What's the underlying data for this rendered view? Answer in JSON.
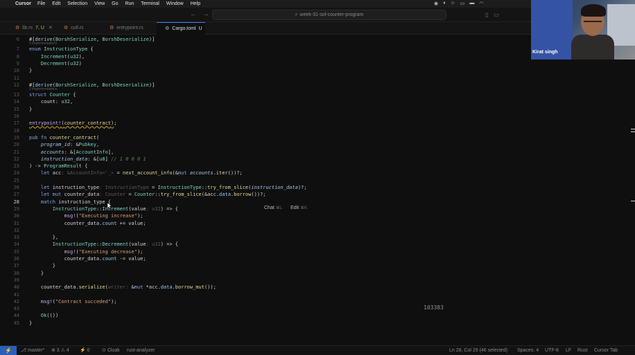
{
  "menubar": {
    "app": "Cursor",
    "items": [
      "File",
      "Edit",
      "Selection",
      "View",
      "Go",
      "Run",
      "Terminal",
      "Window",
      "Help"
    ]
  },
  "titlebar": {
    "search": "week-31-sol-counter-program"
  },
  "tabs": [
    {
      "name": "lib.rs",
      "mod": "7, U",
      "icon": "rust",
      "active": false
    },
    {
      "name": "coll.rs",
      "mod": "",
      "icon": "rust",
      "active": false
    },
    {
      "name": "entrypoint.rs",
      "mod": "",
      "icon": "rust",
      "active": false
    },
    {
      "name": "Cargo.toml",
      "mod": "U",
      "icon": "toml",
      "active": true
    }
  ],
  "editor": {
    "current_line": 28,
    "lines": [
      {
        "n": 6,
        "html": "#[<span class=\"at\">derive</span>(<span class=\"ty\">BorshSerialize</span>, <span class=\"ty\">BorshDeserialize</span>)]"
      },
      {
        "n": 7,
        "html": "<span class=\"kw\">enum</span> <span class=\"ty\">InstructionType</span> {"
      },
      {
        "n": 8,
        "html": "    <span class=\"ty\">Increment</span>(<span class=\"ty\">u32</span>),"
      },
      {
        "n": 9,
        "html": "    <span class=\"ty\">Decrement</span>(<span class=\"ty\">u32</span>)"
      },
      {
        "n": 10,
        "html": "}"
      },
      {
        "n": 11,
        "html": ""
      },
      {
        "n": 12,
        "html": "#[<span class=\"at\">derive</span>(<span class=\"ty\">BorshSerialize</span>, <span class=\"ty\">BorshDeserialize</span>)]"
      },
      {
        "n": 13,
        "html": "<span class=\"kw\">struct</span> <span class=\"ty\">Counter</span> {"
      },
      {
        "n": 14,
        "html": "    count: <span class=\"ty\">u32</span>,"
      },
      {
        "n": 15,
        "html": "}"
      },
      {
        "n": 16,
        "html": ""
      },
      {
        "n": 17,
        "html": "<span class=\"mc sq\">entrypoint!</span><span class=\"sq\">(<span class=\"fn\">counter_contract</span>)</span>;"
      },
      {
        "n": 18,
        "html": ""
      },
      {
        "n": 19,
        "html": "<span class=\"kw\">pub</span> <span class=\"kw\">fn</span> <span class=\"fn\">counter_contract</span>("
      },
      {
        "n": 20,
        "html": "    <span class=\"vi\">program_id</span>: &amp;<span class=\"ty\">Pubkey</span>,"
      },
      {
        "n": 21,
        "html": "    <span class=\"vi\">accounts</span>: &amp;[<span class=\"ty\">AccountInfo</span>],"
      },
      {
        "n": 22,
        "html": "    <span class=\"vi\">instruction_data</span>: &amp;[<span class=\"ty\">u8</span>] <span class=\"cm\">// 1 0 0 0 1</span>"
      },
      {
        "n": 23,
        "html": ") -&gt; <span class=\"ty\">ProgramResult</span> {"
      },
      {
        "n": 24,
        "html": "    <span class=\"kw\">let</span> acc<span class=\"gh\">: &amp;AccountInfo&lt;'_&gt;</span> = <span class=\"fn\">next_account_info</span>(&amp;<span class=\"kw\">mut</span> <span class=\"vi\">accounts</span>.<span class=\"fn\">iter</span>())?;"
      },
      {
        "n": 25,
        "html": ""
      },
      {
        "n": 26,
        "html": "    <span class=\"kw\">let</span> instruction_type<span class=\"gh\">: InstructionType</span> = <span class=\"ty\">InstructionType</span>::<span class=\"fn\">try_from_slice</span>(<span class=\"vi\">instruction_data</span>)?;"
      },
      {
        "n": 27,
        "html": "    <span class=\"kw\">let</span> <span class=\"kw\">mut</span> counter_data<span class=\"gh\">: Counter</span> = <span class=\"ty\">Counter</span>::<span class=\"fn\">try_from_slice</span>(&amp;acc.<span class=\"at\">data</span>.<span class=\"fn\">borrow</span>())?;"
      },
      {
        "n": 28,
        "html": "    <span class=\"kw\">match</span> instruction_type {"
      },
      {
        "n": 29,
        "html": "        <span class=\"ty\">InstructionType</span>::<span class=\"ty\">Increment</span>(value<span class=\"gh\">: u32</span>) =&gt; {"
      },
      {
        "n": 30,
        "html": "            <span class=\"mc\">msg!</span>(<span class=\"st\">\"Executing increase\"</span>);"
      },
      {
        "n": 31,
        "html": "            counter_data.<span class=\"at\">count</span> += value;"
      },
      {
        "n": 32,
        "html": ""
      },
      {
        "n": 33,
        "html": "        },"
      },
      {
        "n": 34,
        "html": "        <span class=\"ty\">InstructionType</span>::<span class=\"ty\">Decrement</span>(value<span class=\"gh\">: u32</span>) =&gt; {"
      },
      {
        "n": 35,
        "html": "            <span class=\"mc\">msg!</span>(<span class=\"st\">\"Executing decrease\"</span>);"
      },
      {
        "n": 36,
        "html": "            counter_data.<span class=\"at\">count</span> -= value;"
      },
      {
        "n": 37,
        "html": "        }"
      },
      {
        "n": 38,
        "html": "    }"
      },
      {
        "n": 39,
        "html": ""
      },
      {
        "n": 40,
        "html": "    counter_data.<span class=\"fn\">serialize</span>(<span class=\"gh\">writer:</span> &amp;<span class=\"kw\">mut</span> *acc.<span class=\"at\">data</span>.<span class=\"fn\">borrow_mut</span>());"
      },
      {
        "n": 41,
        "html": ""
      },
      {
        "n": 42,
        "html": "    <span class=\"mc\">msg!</span>(<span class=\"st\">\"Contract succeded\"</span>);"
      },
      {
        "n": 43,
        "html": ""
      },
      {
        "n": 44,
        "html": "    <span class=\"ty\">Ok</span>(())"
      },
      {
        "n": 45,
        "html": "}"
      }
    ],
    "hints": [
      {
        "after": 6,
        "text": "3 implementations"
      },
      {
        "after": 12,
        "text": "2 implementations"
      }
    ],
    "inline_actions": {
      "chat": "Chat",
      "chat_shortcut": "⌘L",
      "edit": "Edit",
      "edit_shortcut": "⌘K"
    },
    "overlay_number": "103383"
  },
  "statusbar": {
    "branch": "master*",
    "problems": "⊗ 3 ⚠ 4",
    "ports": "⚡ 0",
    "cloak": "Cloak",
    "analyzer": "rust-analyzer",
    "position": "Ln 28, Col 29 (46 selected)",
    "spaces": "Spaces: 4",
    "encoding": "UTF-8",
    "eol": "LF",
    "language": "Rust",
    "extension": "Cursor Tab"
  },
  "webcam": {
    "name": "Kirat singh"
  },
  "colors": {
    "accent": "#3b82f6",
    "background": "#0f0f0f"
  }
}
